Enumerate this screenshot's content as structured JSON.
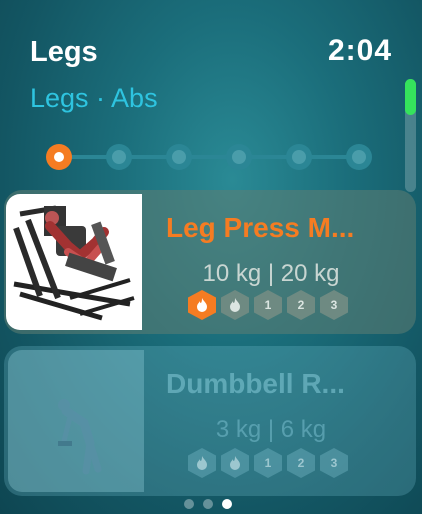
{
  "header": {
    "title": "Legs",
    "subtitle": "Legs · Abs",
    "time": "2:04"
  },
  "progress": {
    "total_steps": 6,
    "current_step": 1
  },
  "exercises": [
    {
      "name": "Leg Press M...",
      "weights": "10 kg | 20 kg",
      "image_icon": "leg-press-machine-illustration",
      "badges": [
        {
          "label": "",
          "icon": "flame-icon",
          "active": true
        },
        {
          "label": "",
          "icon": "flame-icon",
          "active": false
        },
        {
          "label": "1",
          "active": false
        },
        {
          "label": "2",
          "active": false
        },
        {
          "label": "3",
          "active": false
        }
      ]
    },
    {
      "name": "Dumbbell R...",
      "weights": "3 kg | 6 kg",
      "image_icon": "dumbbell-row-figure-illustration",
      "badges": [
        {
          "label": "",
          "icon": "flame-icon",
          "active": false
        },
        {
          "label": "",
          "icon": "flame-icon",
          "active": false
        },
        {
          "label": "1",
          "active": false
        },
        {
          "label": "2",
          "active": false
        },
        {
          "label": "3",
          "active": false
        }
      ]
    }
  ],
  "page_indicator": {
    "pages": 3,
    "current": 3
  },
  "colors": {
    "accent": "#f57c22",
    "subtitle": "#2ec4e0",
    "scroll_thumb": "#35e35c"
  }
}
